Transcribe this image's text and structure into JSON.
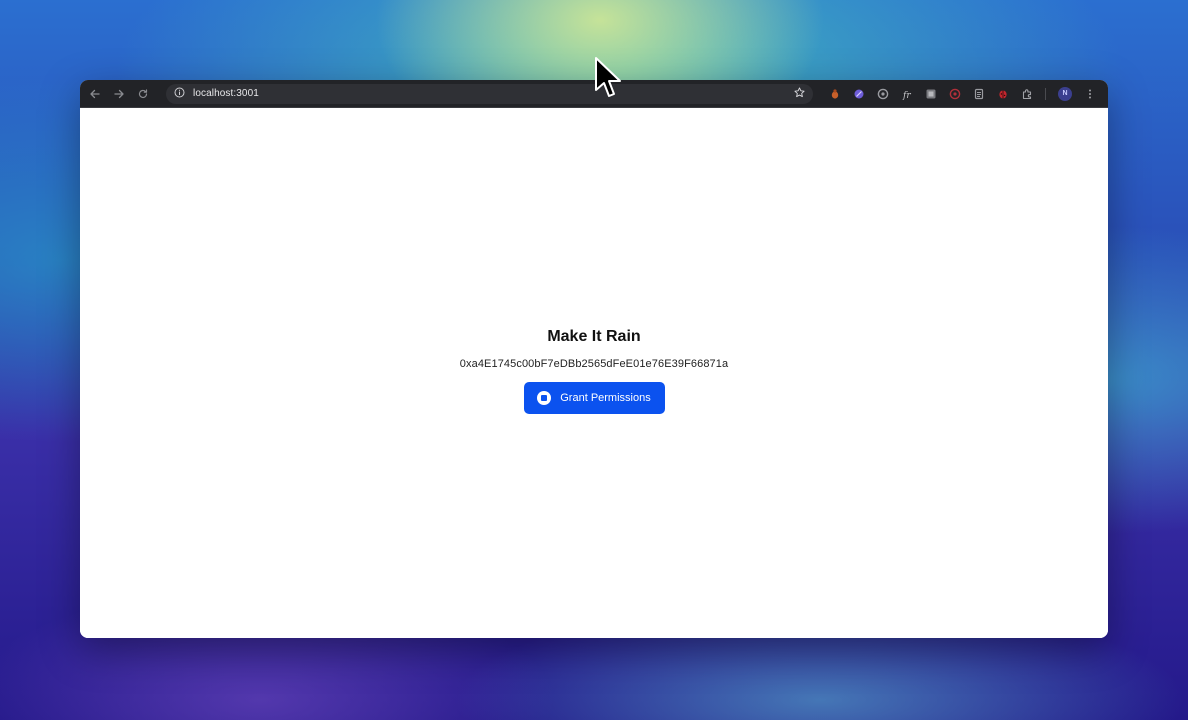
{
  "browser": {
    "url": "localhost:3001",
    "profile_initial": "N"
  },
  "page": {
    "title": "Make It Rain",
    "address": "0xa4E1745c00bF7eDBb2565dFeE01e76E39F66871a",
    "grant_button_label": "Grant Permissions"
  },
  "colors": {
    "accent": "#0b52ef"
  }
}
